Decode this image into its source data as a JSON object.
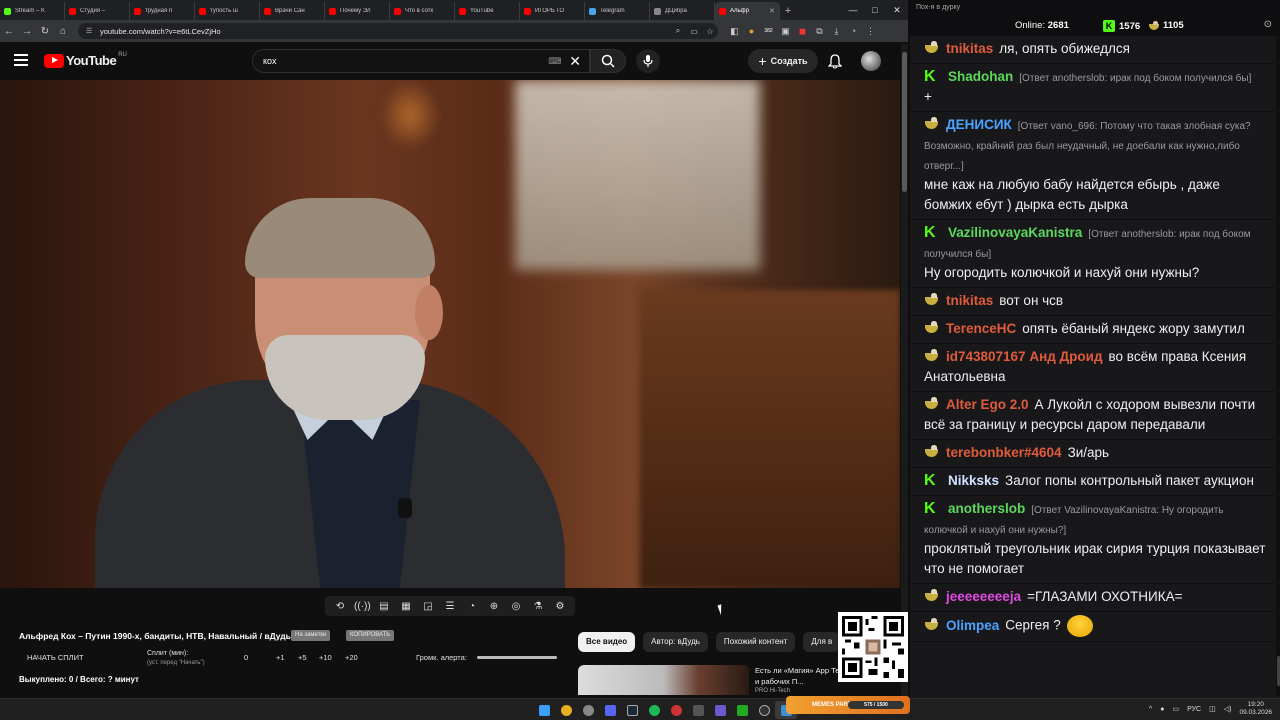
{
  "browser": {
    "tabs": [
      {
        "label": "Stream – K",
        "color": "#53fc18"
      },
      {
        "label": "Студия –",
        "color": "#ff0000"
      },
      {
        "label": "трудная п",
        "color": "#ff0000"
      },
      {
        "label": "тупость ш",
        "color": "#ff0000"
      },
      {
        "label": "Врачи Сан",
        "color": "#ff0000"
      },
      {
        "label": "Почему Эл",
        "color": "#ff0000"
      },
      {
        "label": "Что в сотк",
        "color": "#ff0000"
      },
      {
        "label": "YouTube",
        "color": "#ff0000"
      },
      {
        "label": "ИГОРЬ ГО",
        "color": "#ff0000"
      },
      {
        "label": "Telegram",
        "color": "#4aa3e8"
      },
      {
        "label": "ДЦибра",
        "color": "#888888"
      },
      {
        "label": "Альфр",
        "color": "#ff0000",
        "active": true
      }
    ],
    "url": "youtube.com/watch?v=e6tLCevZjHo",
    "ext_badge": "382"
  },
  "youtube": {
    "logo_text": "YouTube",
    "country": "RU",
    "search_query": "кох",
    "create_label": "Создать"
  },
  "below_video": {
    "title": "Альфред Кох – Путин 1990-х, бандиты, НТВ, Навальный / вДудь",
    "pill_bookmark": "На заметки",
    "pill_copy": "КОПИРОВАТЬ",
    "split_start": "НАЧАТЬ СПЛИТ",
    "split_label": "Сплит (мин):",
    "split_sub": "(уст. перед \"Начать\")",
    "split_values": [
      "0",
      "+1",
      "+5",
      "+10",
      "+20"
    ],
    "alert_label": "Громк. алерта:",
    "bought": "Выкуплено: 0 / Всего: ? минут"
  },
  "chips": [
    "Все видео",
    "Автор: вДудь",
    "Похожий контент",
    "Для в"
  ],
  "rec": {
    "title": "Есть ли «Магия» App Тест в играх и рабочих П...",
    "meta": "PRO Hi-Tech"
  },
  "chat": {
    "window_title": "Пох-я в дурку",
    "online_label": "Online:",
    "online_value": "2681",
    "kick_count": "1576",
    "vk_count": "1105",
    "messages": [
      {
        "badge": "vk",
        "nick": "tnikitas",
        "color": "#e05b3a",
        "reply": "",
        "text": "ля, опять обижедлся"
      },
      {
        "badge": "k",
        "nick": "Shadohan",
        "color": "#5dd85d",
        "reply": "[Ответ anotherslob: ирак под боком получился бы]",
        "text": "+"
      },
      {
        "badge": "vk",
        "nick": "ДЕНИСИК",
        "color": "#4aa3ff",
        "reply": "[Ответ vano_696: Потому что такая злобная сука? Возможно, крайний раз был неудачный, не доебали как нужно,либо отверг...]",
        "text": "мне каж на любую бабу найдется ебырь , даже бомжих ебут ) дырка есть дырка"
      },
      {
        "badge": "k",
        "nick": "VazilinovayaKanistra",
        "color": "#5dd85d",
        "reply": "[Ответ anotherslob: ирак под боком получился бы]",
        "text": "Ну огородить колючкой и нахуй они нужны?"
      },
      {
        "badge": "vk",
        "nick": "tnikitas",
        "color": "#e05b3a",
        "reply": "",
        "text": "вот он чсв"
      },
      {
        "badge": "vk",
        "nick": "TerenceHC",
        "color": "#e05b3a",
        "reply": "",
        "text": "опять ёбаный яндекс жору замутил"
      },
      {
        "badge": "vk",
        "nick": "id743807167 Анд Дроид",
        "color": "#e05b3a",
        "reply": "",
        "text": "во всём права Ксения Анатольевна"
      },
      {
        "badge": "vk",
        "nick": "Alter Ego 2.0",
        "color": "#e05b3a",
        "reply": "",
        "text": "А Лукойл с ходором вывезли почти всё за границу и ресурсы даром передавали"
      },
      {
        "badge": "vk",
        "nick": "terebonbker#4604",
        "color": "#e05b3a",
        "reply": "",
        "text": "Зи/арь"
      },
      {
        "badge": "k",
        "nick": "Nikksks",
        "color": "#cfe2ff",
        "reply": "",
        "text": "Залог попы контрольный пакет аукцион"
      },
      {
        "badge": "k",
        "nick": "anotherslob",
        "color": "#5dd85d",
        "reply": "[Ответ VazilinovayaKanistra: Ну огородить колючкой и нахуй они нужны?]",
        "text": "проклятый треугольник ирак сирия турция показывает что не помогает"
      },
      {
        "badge": "vk",
        "nick": "jeeeeeeeeja",
        "color": "#e04ae0",
        "reply": "",
        "text": "=ГЛАЗАМИ ОХОТНИКА="
      },
      {
        "badge": "vk",
        "nick": "Olimpea",
        "color": "#4aa3ff",
        "reply": "",
        "text": "Сергея ?",
        "emoji": true
      }
    ]
  },
  "taskbar": {
    "lang": "РУС",
    "time": "19:20",
    "date": "09.03.2026",
    "memes_label": "MEMES PARTY",
    "memes_value": "575 / 1500"
  }
}
